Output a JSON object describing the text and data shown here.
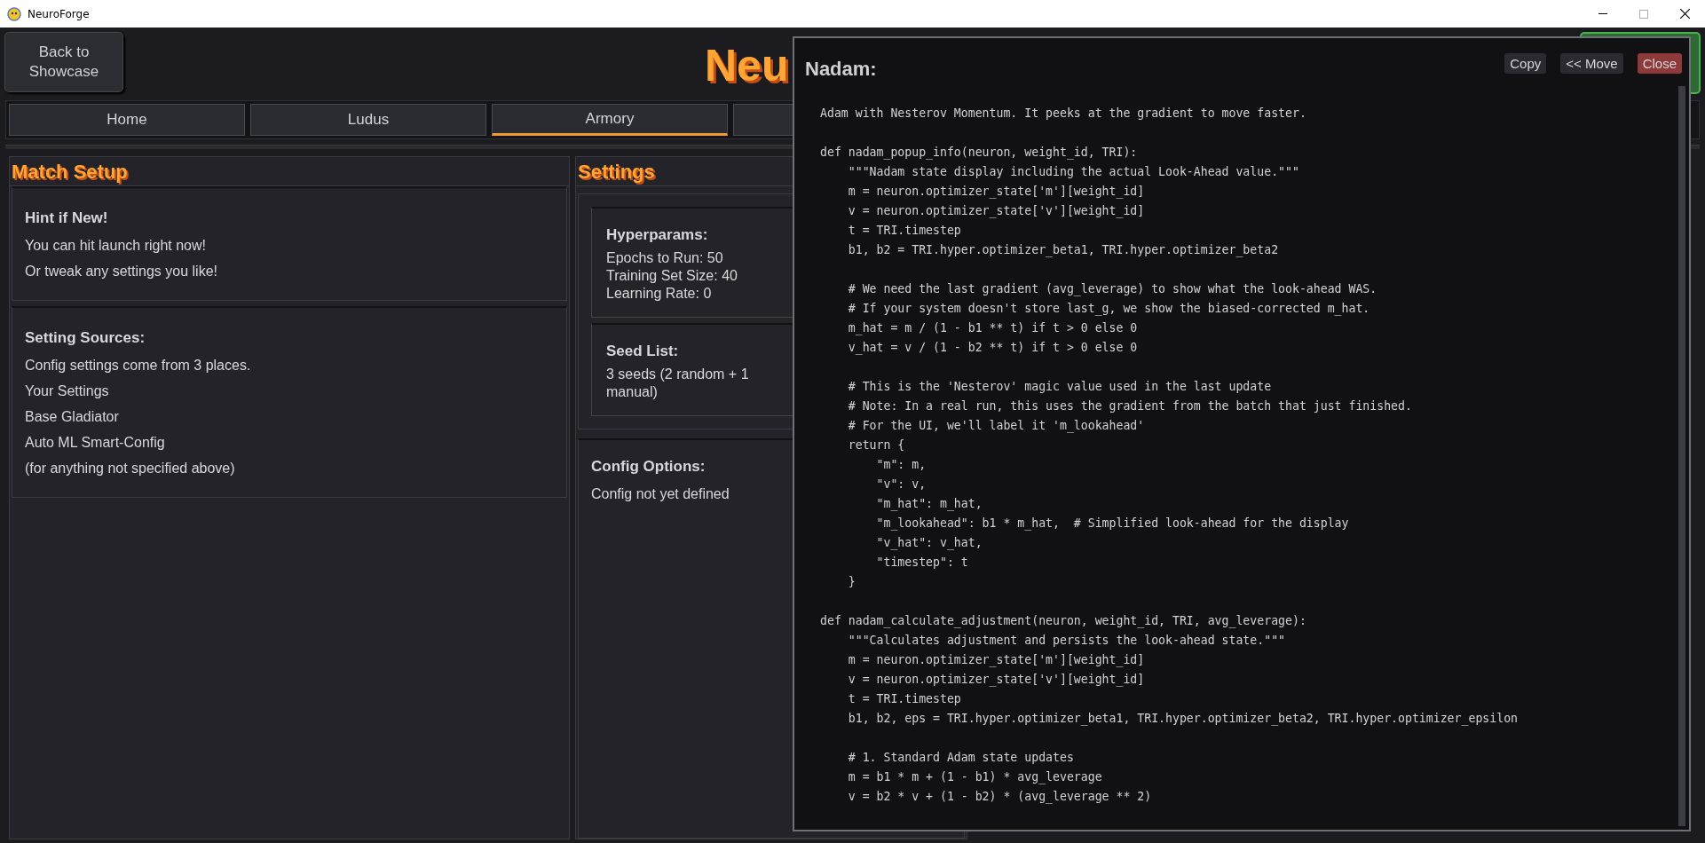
{
  "window": {
    "title": "NeuroForge"
  },
  "header": {
    "back_button": "Back to\nShowcase",
    "title": "Neu"
  },
  "tabs": [
    {
      "label": "Home",
      "selected": false
    },
    {
      "label": "Ludus",
      "selected": false
    },
    {
      "label": "Armory",
      "selected": true
    },
    {
      "selected": false
    }
  ],
  "match_setup": {
    "heading": "Match Setup",
    "cards": [
      {
        "title": "Hint if New!",
        "lines": [
          "You can hit launch right now!",
          "Or tweak any settings you like!"
        ]
      },
      {
        "title": "Setting Sources:",
        "lines": [
          "Config settings come from 3 places.",
          "Your Settings",
          "Base Gladiator",
          "Auto ML Smart-Config",
          "(for anything not specified above)"
        ]
      }
    ]
  },
  "settings": {
    "heading": "Settings",
    "cards": [
      {
        "title": "Hyperparams:",
        "lines": [
          "Epochs to Run: 50",
          "Training Set Size: 40",
          "Learning Rate: 0"
        ]
      },
      {
        "title": "Seed List:",
        "lines": [
          "3 seeds (2 random + 1 manual)"
        ]
      }
    ],
    "config": {
      "title": "Config Options:",
      "text": "Config not yet defined"
    }
  },
  "popup": {
    "title": "Nadam:",
    "buttons": [
      {
        "label": "Copy",
        "kind": "normal"
      },
      {
        "label": "<< Move",
        "kind": "normal"
      },
      {
        "label": "Close",
        "kind": "danger"
      }
    ],
    "code_blocks": [
      [
        "Adam with Nesterov Momentum. It peeks at the gradient to move faster."
      ],
      [
        "def nadam_popup_info(neuron, weight_id, TRI):",
        "    \"\"\"Nadam state display including the actual Look-Ahead value.\"\"\"",
        "    m = neuron.optimizer_state['m'][weight_id]",
        "    v = neuron.optimizer_state['v'][weight_id]",
        "    t = TRI.timestep",
        "    b1, b2 = TRI.hyper.optimizer_beta1, TRI.hyper.optimizer_beta2"
      ],
      [
        "    # We need the last gradient (avg_leverage) to show what the look-ahead WAS.",
        "    # If your system doesn't store last_g, we show the biased-corrected m_hat.",
        "    m_hat = m / (1 - b1 ** t) if t > 0 else 0",
        "    v_hat = v / (1 - b2 ** t) if t > 0 else 0"
      ],
      [
        "    # This is the 'Nesterov' magic value used in the last update",
        "    # Note: In a real run, this uses the gradient from the batch that just finished.",
        "    # For the UI, we'll label it 'm_lookahead'",
        "    return {",
        "        \"m\": m,",
        "        \"v\": v,",
        "        \"m_hat\": m_hat,",
        "        \"m_lookahead\": b1 * m_hat,  # Simplified look-ahead for the display",
        "        \"v_hat\": v_hat,",
        "        \"timestep\": t",
        "    }"
      ],
      [
        "def nadam_calculate_adjustment(neuron, weight_id, TRI, avg_leverage):",
        "    \"\"\"Calculates adjustment and persists the look-ahead state.\"\"\"",
        "    m = neuron.optimizer_state['m'][weight_id]",
        "    v = neuron.optimizer_state['v'][weight_id]",
        "    t = TRI.timestep",
        "    b1, b2, eps = TRI.hyper.optimizer_beta1, TRI.hyper.optimizer_beta2, TRI.hyper.optimizer_epsilon"
      ],
      [
        "    # 1. Standard Adam state updates",
        "    m = b1 * m + (1 - b1) * avg_leverage",
        "    v = b2 * v + (1 - b2) * (avg_leverage ** 2)"
      ]
    ]
  }
}
